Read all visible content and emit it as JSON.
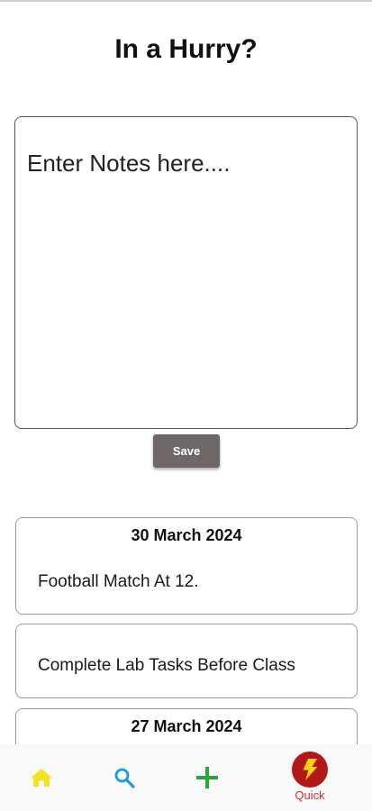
{
  "header": {
    "title": "In a Hurry?"
  },
  "editor": {
    "placeholder": "Enter Notes here....",
    "value": ""
  },
  "save_button": {
    "label": "Save"
  },
  "notes": [
    {
      "date": "30 March 2024",
      "text": "Football Match At 12."
    },
    {
      "date": "",
      "text": "Complete Lab Tasks Before Class"
    },
    {
      "date": "27 March 2024",
      "text": ""
    }
  ],
  "bottom_nav": {
    "items": [
      {
        "icon": "home-icon",
        "label": "",
        "color": "#f2e31f"
      },
      {
        "icon": "search-icon",
        "label": "",
        "color": "#1a9be0"
      },
      {
        "icon": "add-icon",
        "label": "",
        "color": "#2aa63a"
      },
      {
        "icon": "lightning-icon",
        "label": "Quick",
        "color": "#d32f2f",
        "active": true
      }
    ]
  },
  "colors": {
    "save_button": "#6e6767",
    "quick_active": "#b21818",
    "quick_bolt": "#f6d21d"
  }
}
